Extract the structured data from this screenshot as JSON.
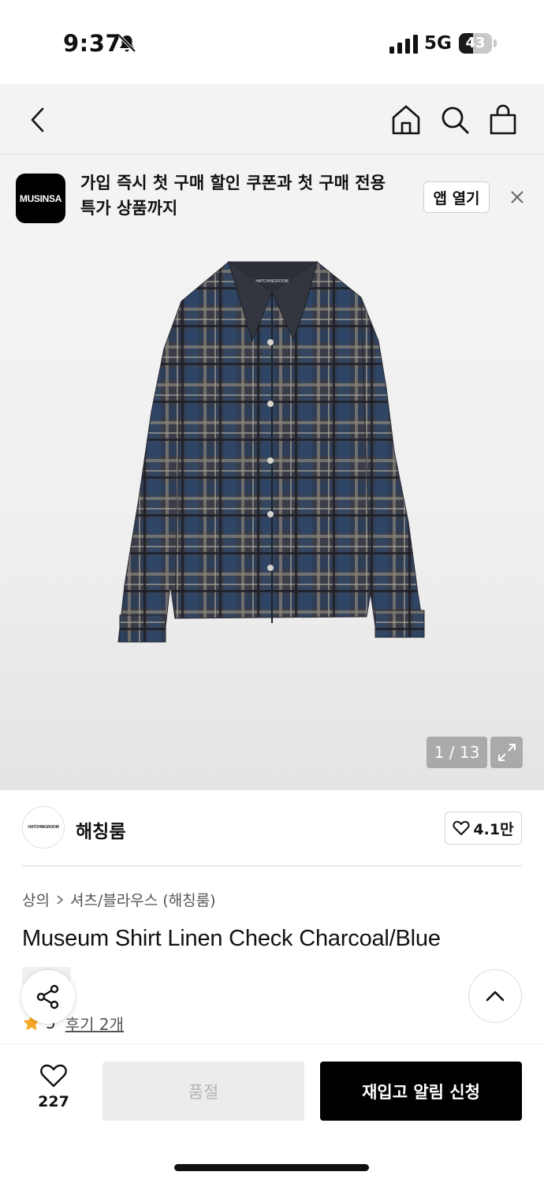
{
  "status_bar": {
    "time": "9:37",
    "network": "5G",
    "battery": "43",
    "battery_level": 0.43
  },
  "banner": {
    "logo_text": "MUSINSA",
    "message": "가입 즉시 첫 구매 할인 쿠폰과 첫 구매 전용 특가 상품까지",
    "open_button": "앱 열기"
  },
  "gallery": {
    "counter": "1 / 13",
    "label_on_shirt": "HATCHINGROOM"
  },
  "brand": {
    "logo_text": "HATCHINGROOM",
    "name": "해칭룸",
    "likes": "4.1만"
  },
  "breadcrumb": [
    "상의",
    "셔츠/블라우스 (해칭룸)"
  ],
  "product": {
    "title": "Museum Shirt Linen Check Charcoal/Blue",
    "rating": "5",
    "reviews": "후기 2개"
  },
  "bottom_bar": {
    "wish_count": "227",
    "soldout_label": "품절",
    "restock_label": "재입고 알림 신청"
  },
  "icons": {
    "back": "chevron-left-icon",
    "home": "home-icon",
    "search": "search-icon",
    "cart": "shopping-bag-icon",
    "close": "close-icon",
    "expand": "expand-icon",
    "heart": "heart-icon",
    "share": "share-icon",
    "up": "chevron-up-icon",
    "star": "star-icon"
  },
  "colors": {
    "accent_star": "#f5a623",
    "button_dark": "#000000",
    "button_disabled": "#ececec"
  }
}
